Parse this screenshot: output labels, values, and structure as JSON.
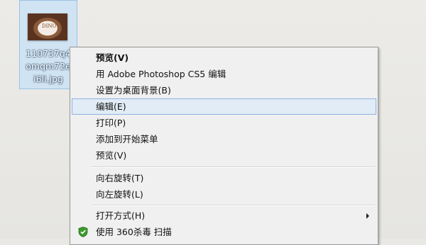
{
  "desktop": {
    "file": {
      "name_lines": [
        "110737q4",
        "omqm72e",
        "i6li.jpg"
      ],
      "thumb_text": "DINO"
    }
  },
  "context_menu": {
    "items": [
      {
        "label": "预览(V)",
        "bold": true
      },
      {
        "label": "用 Adobe Photoshop CS5 编辑"
      },
      {
        "label": "设置为桌面背景(B)"
      },
      {
        "label": "编辑(E)",
        "highlighted": true
      },
      {
        "label": "打印(P)"
      },
      {
        "label": "添加到开始菜单"
      },
      {
        "label": "预览(V)"
      },
      {
        "label": "向右旋转(T)"
      },
      {
        "label": "向左旋转(L)"
      },
      {
        "label": "打开方式(H)",
        "has_submenu": true
      },
      {
        "label": "使用 360杀毒 扫描",
        "icon": "360-shield-icon"
      }
    ]
  }
}
